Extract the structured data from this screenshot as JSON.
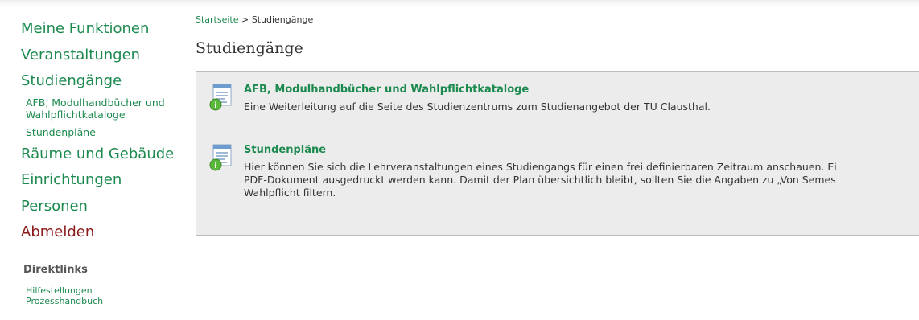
{
  "sidebar": {
    "main_items": [
      {
        "label": "Meine Funktionen"
      },
      {
        "label": "Veranstaltungen"
      },
      {
        "label": "Studiengänge"
      }
    ],
    "sub_items": [
      {
        "label": "AFB, Modulhandbücher und Wahlpflichtkataloge"
      },
      {
        "label": "Stundenpläne"
      }
    ],
    "more_items": [
      {
        "label": "Räume und Gebäude"
      },
      {
        "label": "Einrichtungen"
      },
      {
        "label": "Personen"
      }
    ],
    "logout_label": "Abmelden",
    "direct_links": {
      "heading": "Direktlinks",
      "items": [
        {
          "label": "Hilfestellungen"
        },
        {
          "label": "Prozesshandbuch"
        }
      ]
    }
  },
  "breadcrumb": {
    "home": "Startseite",
    "separator": " > ",
    "current": "Studiengänge"
  },
  "page_title": "Studiengänge",
  "entries": [
    {
      "title": "AFB, Modulhandbücher und Wahlpflichtkataloge",
      "description": "Eine Weiterleitung auf die Seite des Studienzentrums zum Studienangebot der TU Clausthal.",
      "icon": "document-info-icon"
    },
    {
      "title": "Stundenpläne",
      "description": "Hier können Sie sich die Lehrveranstaltungen eines Studiengangs für einen frei definierbaren Zeitraum anschauen. Ei\nPDF-Dokument ausgedruckt werden kann. Damit der Plan übersichtlich bleibt, sollten Sie die Angaben zu „Von Semes\nWahlpflicht filtern.",
      "icon": "document-info-icon"
    }
  ],
  "colors": {
    "link_green": "#1c8a4f",
    "logout_red": "#8b1a1a",
    "box_background": "#ececec"
  }
}
